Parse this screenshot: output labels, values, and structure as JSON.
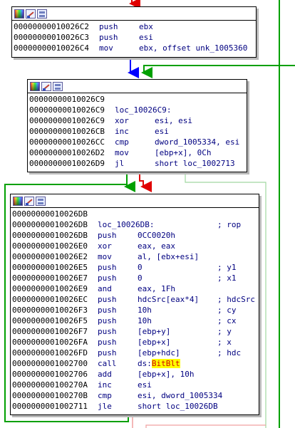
{
  "colors": {
    "flow_true": "#00a000",
    "flow_false": "#e00000",
    "flow_next": "#0000ff",
    "flow_faded": "#a0d8a0",
    "flow_faded_red": "#f0a0a0",
    "highlight": "#ffff00"
  },
  "toolbar_icons": [
    "node-color-icon",
    "rename-pen-icon",
    "graph-view-icon"
  ],
  "block1": {
    "lines": [
      {
        "addr": "00000000010026C2",
        "mn": "push",
        "op": "ebx",
        "cm": ""
      },
      {
        "addr": "00000000010026C3",
        "mn": "push",
        "op": "esi",
        "cm": ""
      },
      {
        "addr": "00000000010026C4",
        "mn": "mov",
        "op": "ebx, offset unk_1005360",
        "cm": ""
      }
    ]
  },
  "block2": {
    "lines": [
      {
        "addr": "00000000010026C9",
        "mn": "",
        "op": "",
        "cm": ""
      },
      {
        "addr": "00000000010026C9",
        "mn": "loc_10026C9:",
        "op": "",
        "cm": ""
      },
      {
        "addr": "00000000010026C9",
        "mn": "xor",
        "op": "esi, esi",
        "cm": ""
      },
      {
        "addr": "00000000010026CB",
        "mn": "inc",
        "op": "esi",
        "cm": ""
      },
      {
        "addr": "00000000010026CC",
        "mn": "cmp",
        "op": "dword_1005334, esi",
        "cm": ""
      },
      {
        "addr": "00000000010026D2",
        "mn": "mov",
        "op": "[ebp+x], 0Ch",
        "cm": ""
      },
      {
        "addr": "00000000010026D9",
        "mn": "jl",
        "op": "short loc_1002713",
        "cm": ""
      }
    ]
  },
  "block3": {
    "lines": [
      {
        "addr": "00000000010026DB",
        "mn": "",
        "op": "",
        "cm": ""
      },
      {
        "addr": "00000000010026DB",
        "mn": "loc_10026DB:",
        "op": "",
        "cm": "; rop"
      },
      {
        "addr": "00000000010026DB",
        "mn": "push",
        "op": "0CC0020h",
        "cm": ""
      },
      {
        "addr": "00000000010026E0",
        "mn": "xor",
        "op": "eax, eax",
        "cm": ""
      },
      {
        "addr": "00000000010026E2",
        "mn": "mov",
        "op": "al, [ebx+esi]",
        "cm": ""
      },
      {
        "addr": "00000000010026E5",
        "mn": "push",
        "op": "0",
        "cm": "; y1"
      },
      {
        "addr": "00000000010026E7",
        "mn": "push",
        "op": "0",
        "cm": "; x1"
      },
      {
        "addr": "00000000010026E9",
        "mn": "and",
        "op": "eax, 1Fh",
        "cm": ""
      },
      {
        "addr": "00000000010026EC",
        "mn": "push",
        "op": "hdcSrc[eax*4]",
        "cm": "; hdcSrc"
      },
      {
        "addr": "00000000010026F3",
        "mn": "push",
        "op": "10h",
        "cm": "; cy"
      },
      {
        "addr": "00000000010026F5",
        "mn": "push",
        "op": "10h",
        "cm": "; cx"
      },
      {
        "addr": "00000000010026F7",
        "mn": "push",
        "op": "[ebp+y]",
        "cm": "; y"
      },
      {
        "addr": "00000000010026FA",
        "mn": "push",
        "op": "[ebp+x]",
        "cm": "; x"
      },
      {
        "addr": "00000000010026FD",
        "mn": "push",
        "op": "[ebp+hdc]",
        "cm": "; hdc"
      },
      {
        "addr": "0000000001002700",
        "mn": "call",
        "op": "ds:",
        "op_hl": "BitBlt",
        "cm": ""
      },
      {
        "addr": "0000000001002706",
        "mn": "add",
        "op": "[ebp+x], 10h",
        "cm": ""
      },
      {
        "addr": "000000000100270A",
        "mn": "inc",
        "op": "esi",
        "cm": ""
      },
      {
        "addr": "000000000100270B",
        "mn": "cmp",
        "op": "esi, dword_1005334",
        "cm": ""
      },
      {
        "addr": "0000000001002711",
        "mn": "jle",
        "op": "short loc_10026DB",
        "cm": ""
      }
    ]
  }
}
